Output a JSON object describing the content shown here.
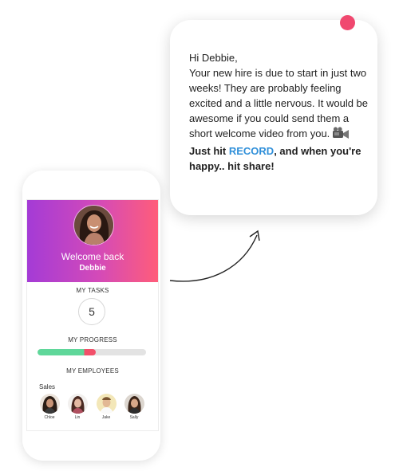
{
  "bubble": {
    "greeting": "Hi Debbie,",
    "body": "Your new hire is due to start in just two weeks! They are probably feeling excited and a little nervous. It would be awesome if you could send them a short welcome video from you.",
    "cta_before": "Just hit ",
    "cta_record": "RECORD",
    "cta_after": ", and when you're happy.. hit share!",
    "camera_icon": "video-camera-icon",
    "accent_color": "#2f8fd9",
    "dot_color": "#f0486f"
  },
  "phone": {
    "header": {
      "welcome": "Welcome back",
      "name": "Debbie",
      "gradient": [
        "#a43bd6",
        "#ff5d7a"
      ]
    },
    "tasks": {
      "label": "MY TASKS",
      "count": "5"
    },
    "progress": {
      "label": "MY PROGRESS",
      "value_fraction": 0.54
    },
    "employees": {
      "label": "MY EMPLOYEES",
      "group": "Sales",
      "people": [
        {
          "name": "Chloe"
        },
        {
          "name": "Lin"
        },
        {
          "name": "Jake"
        },
        {
          "name": "Sally"
        }
      ]
    }
  }
}
